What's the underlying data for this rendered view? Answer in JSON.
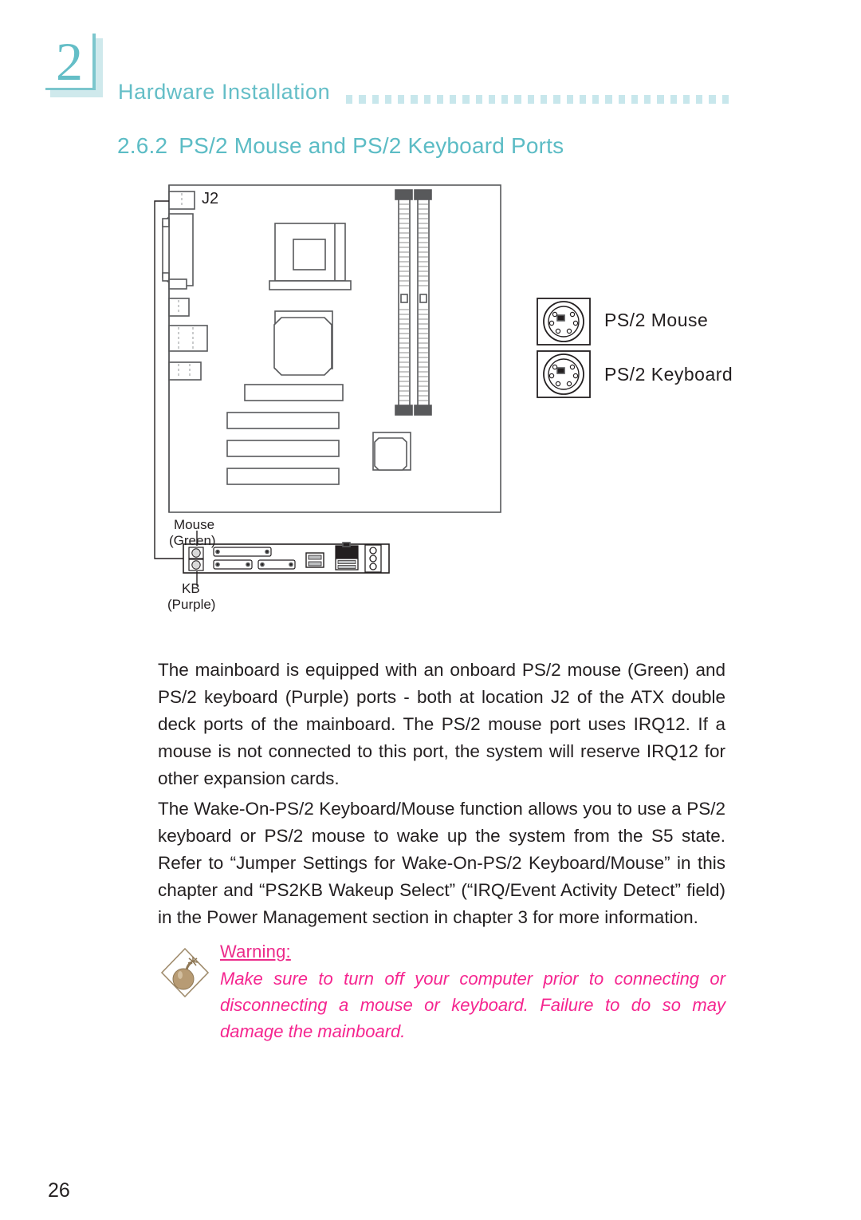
{
  "header": {
    "chapter_number": "2",
    "title": "Hardware Installation",
    "dot_count": 30,
    "accent_color": "#64bec7",
    "dot_color": "#c8e7ec"
  },
  "section": {
    "number": "2.6.2",
    "title": "PS/2 Mouse and PS/2 Keyboard Ports",
    "color": "#5cbcc5"
  },
  "figure": {
    "connector_label": "J2",
    "callouts": {
      "mouse": "Mouse",
      "mouse_color": "(Green)",
      "kb": "KB",
      "kb_color": "(Purple)"
    },
    "port_legend": [
      {
        "label": "PS/2 Mouse",
        "icon": "ps2-din-connector-icon"
      },
      {
        "label": "PS/2 Keyboard",
        "icon": "ps2-din-connector-icon"
      }
    ],
    "board_parts": [
      "ps2-double-deck-port",
      "parallel-port",
      "serial-port",
      "vga-port",
      "usb-ports",
      "cpu-socket-heatsink",
      "chipset",
      "dimm-slot-1",
      "dimm-slot-2",
      "agp-slot",
      "pci-slot-1",
      "pci-slot-2",
      "pci-slot-3",
      "bios-chip"
    ],
    "rear_panel_ports": [
      "ps2-mouse-port",
      "ps2-keyboard-port",
      "parallel-port",
      "serial-port",
      "vga-port",
      "usb-port-pair",
      "rj45-lan-port",
      "usb-port-pair-2",
      "audio-jack-1",
      "audio-jack-2",
      "audio-jack-3"
    ]
  },
  "body": {
    "paragraph_1": "The mainboard is equipped with an onboard PS/2 mouse (Green) and PS/2 keyboard (Purple) ports - both at location J2 of the ATX double deck ports of the mainboard. The PS/2 mouse port uses IRQ12. If a mouse is not connected to this port, the system will reserve IRQ12 for other expansion cards.",
    "paragraph_2": "The Wake-On-PS/2 Keyboard/Mouse function allows you to use a PS/2 keyboard or PS/2 mouse to wake up the system from the S5 state. Refer to “Jumper Settings for Wake-On-PS/2 Keyboard/Mouse” in this chapter and “PS2KB Wakeup Select” (“IRQ/Event Activity Detect” field) in the Power Management section in chapter 3 for more information."
  },
  "warning": {
    "icon": "bomb-warning-icon",
    "title": "Warning:",
    "text": "Make sure to turn off your computer prior to connecting or disconnecting a mouse or keyboard. Failure to do so may damage the mainboard.",
    "color": "#f5258f",
    "icon_fill": "#b79b74"
  },
  "footer": {
    "page_number": "26"
  }
}
